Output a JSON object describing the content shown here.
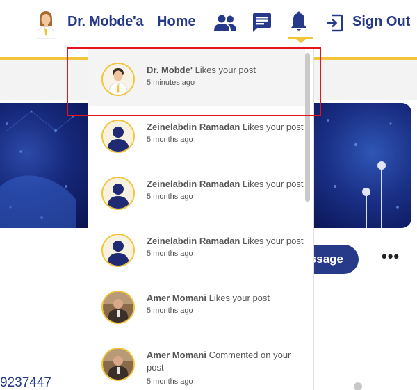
{
  "nav": {
    "username": "Dr. Mobde'a",
    "home": "Home",
    "sign_out": "Sign Out",
    "icons": [
      "avatar",
      "people-icon",
      "chat-icon",
      "bell-icon",
      "sign-out-icon"
    ],
    "accent_color": "#f2c53d",
    "brand_color": "#273a8a"
  },
  "background_page": {
    "message_button": "ssage",
    "phone_partial": "9237447",
    "more_icon": "more-icon"
  },
  "notifications": [
    {
      "who": "Dr. Mobde'",
      "action": "Likes your post",
      "time": "5 minutes ago",
      "avatar": "doctor",
      "selected": true
    },
    {
      "who": "Zeinelabdin Ramadan",
      "action": "Likes your post",
      "time": "5 months ago",
      "avatar": "default"
    },
    {
      "who": "Zeinelabdin Ramadan",
      "action": "Likes your post",
      "time": "5 months ago",
      "avatar": "default"
    },
    {
      "who": "Zeinelabdin Ramadan",
      "action": "Likes your post",
      "time": "5 months ago",
      "avatar": "default"
    },
    {
      "who": "Amer Momani",
      "action": "Likes your post",
      "time": "5 months ago",
      "avatar": "photo"
    },
    {
      "who": "Amer Momani",
      "action": "Commented on your post",
      "time": "5 months ago",
      "avatar": "photo"
    }
  ]
}
